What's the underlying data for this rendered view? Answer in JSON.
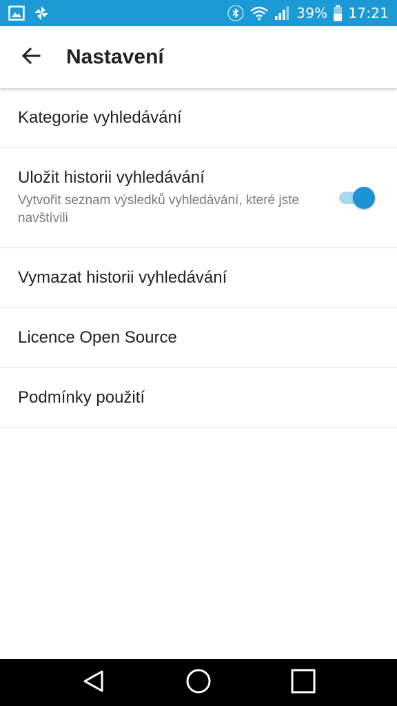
{
  "colors": {
    "status_bar": "#1c9ad6",
    "accent": "#1c94d3",
    "toggle_track": "#a7d9f1",
    "title_text": "#222222",
    "summary_text": "#7a7a7a"
  },
  "status_bar": {
    "icons_left": [
      "gallery-icon",
      "pinwheel-app-icon"
    ],
    "icons_right": [
      "bluetooth-icon",
      "wifi-icon",
      "cell-signal-icon",
      "battery-icon"
    ],
    "battery": "39%",
    "time": "17:21"
  },
  "app_bar": {
    "back_icon": "back-arrow-icon",
    "title": "Nastavení"
  },
  "settings": {
    "search_categories": {
      "title": "Kategorie vyhledávání"
    },
    "save_history": {
      "title": "Uložit historii vyhledávání",
      "summary": "Vytvořit seznam výsledků vyhledávání, které jste navštívili",
      "enabled": true
    },
    "clear_history": {
      "title": "Vymazat historii vyhledávání"
    },
    "open_source": {
      "title": "Licence Open Source"
    },
    "terms": {
      "title": "Podmínky použití"
    }
  },
  "nav_bar": {
    "back": "nav-back-icon",
    "home": "nav-home-icon",
    "recents": "nav-recents-icon"
  }
}
